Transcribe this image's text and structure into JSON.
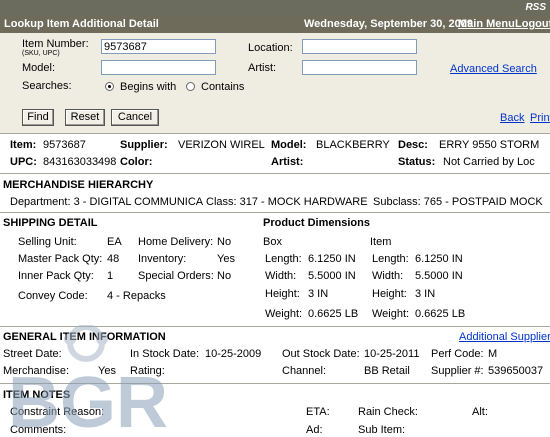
{
  "header": {
    "rss": "RSS",
    "title": "Lookup Item Additional Detail",
    "date": "Wednesday, September 30, 2009",
    "main_menu": "Main Menu",
    "logout": "Logout"
  },
  "search": {
    "item_number_label": "Item Number:",
    "item_number_sub": "(SKU, UPC)",
    "item_number_value": "9573687",
    "model_label": "Model:",
    "model_value": "",
    "location_label": "Location:",
    "location_value": "",
    "artist_label": "Artist:",
    "artist_value": "",
    "advanced_search": "Advanced Search",
    "searches_label": "Searches:",
    "begins_with": "Begins with",
    "contains": "Contains",
    "find": "Find",
    "reset": "Reset",
    "cancel": "Cancel",
    "back": "Back",
    "print": "Print"
  },
  "summary": {
    "item_label": "Item:",
    "item_value": "9573687",
    "supplier_label": "Supplier:",
    "supplier_value": "VERIZON WIREL",
    "model_label": "Model:",
    "model_value": "BLACKBERRY",
    "desc_label": "Desc:",
    "desc_value": "ERRY 9550 STORM",
    "upc_label": "UPC:",
    "upc_value": "843163033498",
    "color_label": "Color:",
    "color_value": "",
    "artist_label": "Artist:",
    "artist_value": "",
    "status_label": "Status:",
    "status_value": "Not Carried by Loc"
  },
  "hierarchy": {
    "heading": "MERCHANDISE HIERARCHY",
    "department": "Department: 3 - DIGITAL COMMUNICA",
    "class": "Class: 317 - MOCK HARDWARE",
    "subclass": "Subclass: 765 - POSTPAID MOCK"
  },
  "shipping": {
    "heading": "SHIPPING DETAIL",
    "rows": [
      {
        "label": "Selling Unit:",
        "value": "EA",
        "label2": "Home Delivery:",
        "value2": "No"
      },
      {
        "label": "Master Pack Qty:",
        "value": "48",
        "label2": "Inventory:",
        "value2": "Yes"
      },
      {
        "label": "Inner Pack Qty:",
        "value": "1",
        "label2": "Special Orders:",
        "value2": "No"
      }
    ],
    "convey_label": "Convey Code:",
    "convey_value": "4 - Repacks"
  },
  "dimensions": {
    "heading": "Product Dimensions",
    "box_label": "Box",
    "item_label": "Item",
    "length_label": "Length:",
    "box_length": "6.1250 IN",
    "item_length": "6.1250 IN",
    "width_label": "Width:",
    "box_width": "5.5000 IN",
    "item_width": "5.5000 IN",
    "height_label": "Height:",
    "box_height": "3 IN",
    "item_height": "3 IN",
    "weight_label": "Weight:",
    "box_weight": "0.6625 LB",
    "item_weight": "0.6625 LB"
  },
  "general": {
    "heading": "GENERAL ITEM INFORMATION",
    "additional_suppliers": "Additional Suppliers",
    "street_date_label": "Street Date:",
    "in_stock_label": "In Stock Date:",
    "in_stock_value": "10-25-2009",
    "out_stock_label": "Out Stock Date:",
    "out_stock_value": "10-25-2011",
    "perf_code_label": "Perf Code:",
    "perf_code_value": "M",
    "merchandise_label": "Merchandise:",
    "merchandise_value": "Yes",
    "rating_label": "Rating:",
    "channel_label": "Channel:",
    "channel_value": "BB Retail",
    "supplier_num_label": "Supplier #:",
    "supplier_num_value": "539650037"
  },
  "notes": {
    "heading": "ITEM NOTES",
    "constraint_label": "Constraint Reason:",
    "eta_label": "ETA:",
    "rain_check_label": "Rain Check:",
    "alt_label": "Alt:",
    "comments_label": "Comments:",
    "ad_label": "Ad:",
    "sub_item_label": "Sub Item:"
  },
  "watermark": {
    "text": "BGR"
  },
  "colors": {
    "header_bg": "#6e6b5a",
    "panel_bg": "#efede2",
    "link": "#0033cc"
  }
}
